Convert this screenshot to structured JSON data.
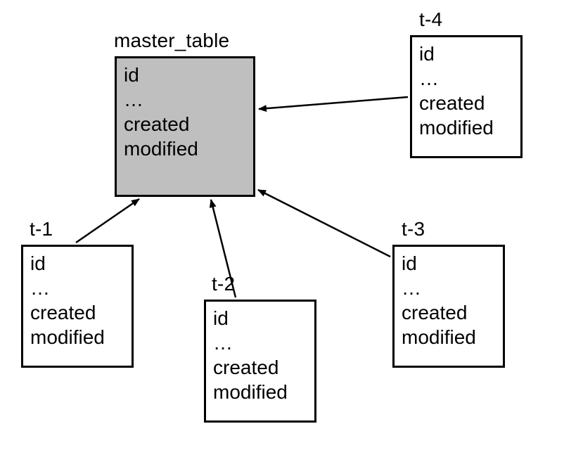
{
  "diagram": {
    "master": {
      "label": "master_table",
      "fields": [
        "id",
        "…",
        "created",
        "modified"
      ]
    },
    "tables": [
      {
        "label": "t-1",
        "fields": [
          "id",
          "…",
          "created",
          "modified"
        ]
      },
      {
        "label": "t-2",
        "fields": [
          "id",
          "…",
          "created",
          "modified"
        ]
      },
      {
        "label": "t-3",
        "fields": [
          "id",
          "…",
          "created",
          "modified"
        ]
      },
      {
        "label": "t-4",
        "fields": [
          "id",
          "…",
          "created",
          "modified"
        ]
      }
    ]
  }
}
